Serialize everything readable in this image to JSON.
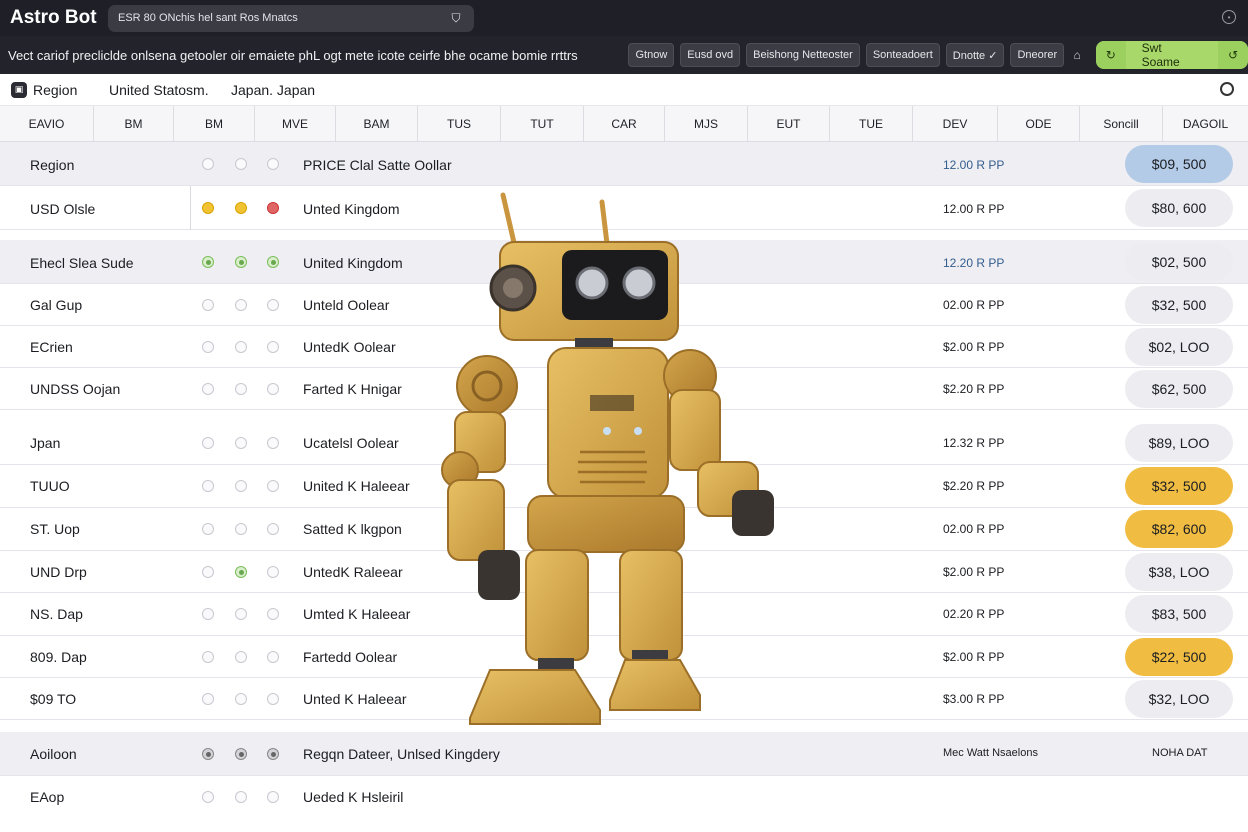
{
  "app": {
    "title": "Astro Bot"
  },
  "search": {
    "value": "ESR 80 ONchis hel sant Ros Mnatcs"
  },
  "toolbar": {
    "info": "Vect cariof precliclde onlsena getooler oir emaiete phL ogt mete icote ceirfe bhe ocame bomie rrttrs",
    "buttons": [
      "Gtnow",
      "Eusd ovd",
      "Beishong Netteoster",
      "Sonteadoert",
      "Dnotte ✓",
      "Dneorer"
    ],
    "action_label": "Swt Soame"
  },
  "filter": {
    "label": "Region",
    "value1": "United Statosm.",
    "value2": "Japan. Japan"
  },
  "columns": [
    "EAVIO",
    "BM",
    "BM",
    "MVE",
    "BAM",
    "TUS",
    "TUT",
    "CAR",
    "MJS",
    "EUT",
    "TUE",
    "DEV",
    "ODE",
    "Soncill",
    "DAGOIL"
  ],
  "rows": [
    {
      "name": "Region",
      "dots": [
        "empty",
        "empty",
        "empty"
      ],
      "desc": "PRICE Clal Satte Oollar",
      "rate": "12.00 R PP",
      "price": "$09, 500"
    },
    {
      "name": "USD Olsle",
      "dots": [
        "yellow",
        "yellow",
        "red"
      ],
      "desc": "Unted Kingdom",
      "rate": "12.00 R PP",
      "price": "$80, 600"
    },
    {
      "name": "Ehecl Slea Sude",
      "dots": [
        "green",
        "green",
        "green"
      ],
      "desc": "United Kingdom",
      "rate": "12.20 R PP",
      "price": "$02, 500"
    },
    {
      "name": "Gal Gup",
      "dots": [
        "empty",
        "empty",
        "empty"
      ],
      "desc": "Unteld Oolear",
      "rate": "02.00 R PP",
      "price": "$32, 500"
    },
    {
      "name": "ECrien",
      "dots": [
        "empty",
        "empty",
        "empty"
      ],
      "desc": "UntedK Oolear",
      "rate": "$2.00 R PP",
      "price": "$02, LOO"
    },
    {
      "name": "UNDSS Oojan",
      "dots": [
        "empty",
        "empty",
        "empty"
      ],
      "desc": "Farted K Hnigar",
      "rate": "$2.20 R PP",
      "price": "$62, 500"
    },
    {
      "name": "Jpan",
      "dots": [
        "empty",
        "empty",
        "empty"
      ],
      "desc": "Ucatelsl Oolear",
      "rate": "12.32 R PP",
      "price": "$89, LOO"
    },
    {
      "name": "TUUO",
      "dots": [
        "empty",
        "empty",
        "empty"
      ],
      "desc": "United K Haleear",
      "rate": "$2.20 R PP",
      "price": "$32, 500"
    },
    {
      "name": "ST. Uop",
      "dots": [
        "empty",
        "empty",
        "empty"
      ],
      "desc": "Satted K lkgpon",
      "rate": "02.00 R PP",
      "price": "$82, 600"
    },
    {
      "name": "UND Drp",
      "dots": [
        "empty",
        "green",
        "empty"
      ],
      "desc": "UntedK Raleear",
      "rate": "$2.00 R PP",
      "price": "$38, LOO"
    },
    {
      "name": "NS. Dap",
      "dots": [
        "empty",
        "empty",
        "empty"
      ],
      "desc": "Umted K Haleear",
      "rate": "02.20 R PP",
      "price": "$83, 500"
    },
    {
      "name": "809. Dap",
      "dots": [
        "empty",
        "empty",
        "empty"
      ],
      "desc": "Fartedd Oolear",
      "rate": "$2.00 R PP",
      "price": "$22, 500"
    },
    {
      "name": "$09 TO",
      "dots": [
        "empty",
        "empty",
        "empty"
      ],
      "desc": "Unted K Haleear",
      "rate": "$3.00 R PP",
      "price": "$32, LOO"
    },
    {
      "name": "Aoiloon",
      "dots": [
        "grey",
        "grey",
        "grey"
      ],
      "desc": "Regqn Dateer, Unlsed Kingdery",
      "rate": "Mec Watt Nsaelons",
      "price": "NOHA DAT"
    },
    {
      "name": "EAop",
      "dots": [
        "empty",
        "empty",
        "empty"
      ],
      "desc": "Ueded K Hsleiril"
    }
  ],
  "colors": {
    "accent_green": "#a9d86a",
    "pill_yellow": "#f0bd42",
    "pill_blue": "#b3cbe6",
    "topbar": "#1f2027"
  }
}
